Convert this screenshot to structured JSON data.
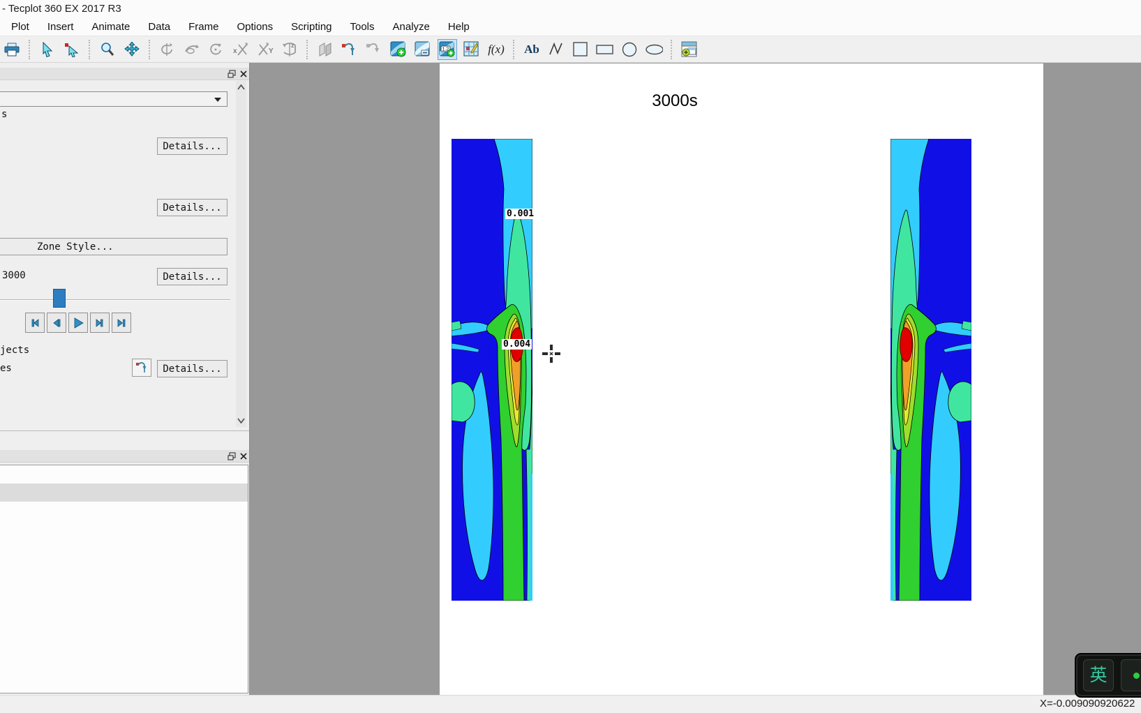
{
  "window": {
    "title": "- Tecplot 360 EX 2017 R3"
  },
  "menu": {
    "items": [
      "Plot",
      "Insert",
      "Animate",
      "Data",
      "Frame",
      "Options",
      "Scripting",
      "Tools",
      "Analyze",
      "Help"
    ]
  },
  "toolbar": {
    "fx_label": "f(x)",
    "text_tool_label": "Ab"
  },
  "sidebar": {
    "layers_text": "s",
    "details_label": "Details...",
    "zone_style_label": "Zone Style...",
    "solution_time": "3000",
    "derived_objects_text": "jects",
    "streamtraces_text": "es"
  },
  "plot": {
    "title": "3000s",
    "contour_labels": [
      "0.001",
      "0.004"
    ]
  },
  "status_bar": {
    "coordinate": "X=-0.009090920622"
  },
  "ime": {
    "mode": "英"
  },
  "colors": {
    "contour_scale": [
      "#1010e6",
      "#33ccff",
      "#40e6a0",
      "#30d030",
      "#9fdd2d",
      "#e8e830",
      "#f0a028",
      "#e00000"
    ],
    "selected_tool_bg": "#cde4f6",
    "slider_handle": "#2d7dc0",
    "workspace_gray": "#989898"
  }
}
